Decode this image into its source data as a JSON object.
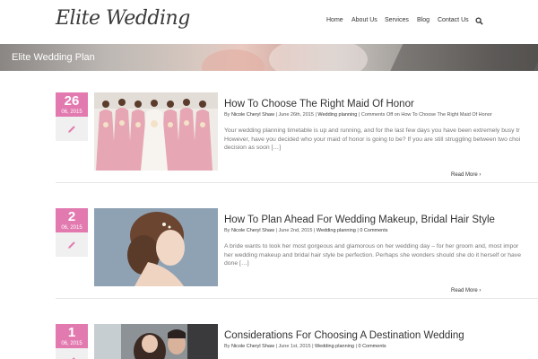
{
  "header": {
    "logo": "Elite Wedding",
    "nav": [
      {
        "label": "Home"
      },
      {
        "label": "About Us"
      },
      {
        "label": "Services"
      },
      {
        "label": "Blog"
      },
      {
        "label": "Contact Us"
      }
    ],
    "search_icon": "search-icon"
  },
  "banner": {
    "title": "Elite Wedding Plan"
  },
  "colors": {
    "accent_pink": "#e27ab0",
    "text_dark": "#333333",
    "text_muted": "#777777"
  },
  "posts": [
    {
      "day": "26",
      "month_year": "06, 2015",
      "format_icon": "pencil-icon",
      "title": "How To Choose The Right Maid Of Honor",
      "meta": {
        "by": "By",
        "author": "Nicole Cheryl Shaw",
        "date": "June 26th, 2015",
        "category": "Wedding planning",
        "comments": "Comments Off on How To Choose The Right Maid Of Honor"
      },
      "excerpt_lines": [
        "Your wedding planning timetable is up and running, and for the last few days you have been extremely busy tr",
        "However, have you decided who your maid of honor is going to be? If you are still struggling between two choi",
        "decision as soon […]"
      ],
      "read_more": "Read More"
    },
    {
      "day": "2",
      "month_year": "06, 2015",
      "format_icon": "pencil-icon",
      "title": "How To Plan Ahead For Wedding Makeup, Bridal Hair Style",
      "meta": {
        "by": "By",
        "author": "Nicole Cheryl Shaw",
        "date": "June 2nd, 2015",
        "category": "Wedding planning",
        "comments": "0 Comments"
      },
      "excerpt_lines": [
        "A bride wants to look her most gorgeous and glamorous on her wedding day – for her groom and, most impor",
        "her wedding makeup and bridal hair style be perfection. Perhaps she wonders should she do it herself or have",
        "done […]"
      ],
      "read_more": "Read More"
    },
    {
      "day": "1",
      "month_year": "06, 2015",
      "format_icon": "pencil-icon",
      "title": "Considerations For Choosing A Destination Wedding",
      "meta": {
        "by": "By",
        "author": "Nicole Cheryl Shaw",
        "date": "June 1st, 2015",
        "category": "Wedding planning",
        "comments": "0 Comments"
      },
      "excerpt_lines": [],
      "read_more": ""
    }
  ]
}
